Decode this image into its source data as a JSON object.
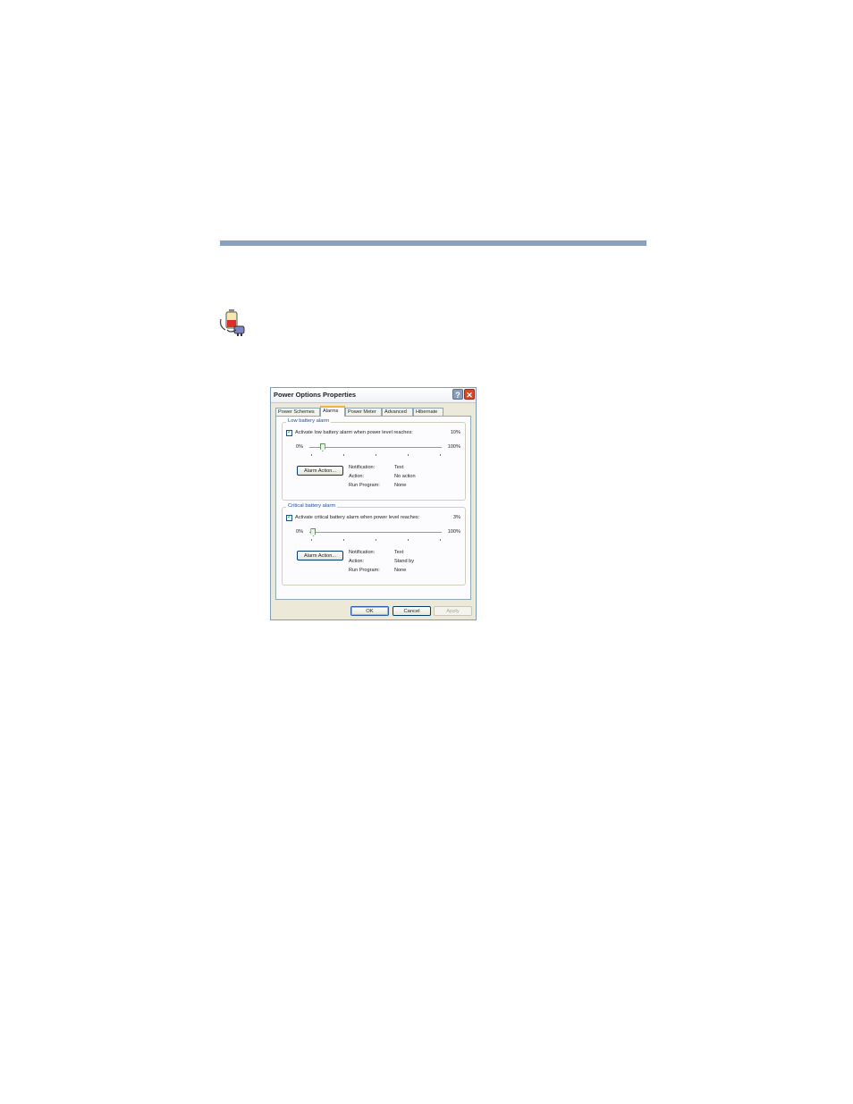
{
  "dialog": {
    "title": "Power Options Properties",
    "help_label": "?",
    "close_label": "✕"
  },
  "tabs": [
    {
      "label": "Power Schemes"
    },
    {
      "label": "Alarms"
    },
    {
      "label": "Power Meter"
    },
    {
      "label": "Advanced"
    },
    {
      "label": "Hibernate"
    }
  ],
  "active_tab": "Alarms",
  "low_alarm": {
    "group_label": "Low battery alarm",
    "checkbox_label": "Activate low battery alarm when power level reaches:",
    "checked": true,
    "value_label": "10%",
    "level_percent": 10,
    "min_label": "0%",
    "max_label": "100%",
    "button_label": "Alarm Action...",
    "notification_label": "Notification:",
    "notification_value": "Text",
    "action_label": "Action:",
    "action_value": "No action",
    "program_label": "Run Program:",
    "program_value": "None"
  },
  "critical_alarm": {
    "group_label": "Critical battery alarm",
    "checkbox_label": "Activate critical battery alarm when power level reaches:",
    "checked": true,
    "value_label": "3%",
    "level_percent": 3,
    "min_label": "0%",
    "max_label": "100%",
    "button_label": "Alarm Action...",
    "notification_label": "Notification:",
    "notification_value": "Text",
    "action_label": "Action:",
    "action_value": "Stand by",
    "program_label": "Run Program:",
    "program_value": "None"
  },
  "buttons": {
    "ok": "OK",
    "cancel": "Cancel",
    "apply": "Apply"
  },
  "icons": {
    "page_icon": "battery-plug-icon"
  },
  "colors": {
    "rule": "#8aa1bd",
    "tab_highlight": "#f0b43c",
    "group_label": "#1f4ea3"
  }
}
